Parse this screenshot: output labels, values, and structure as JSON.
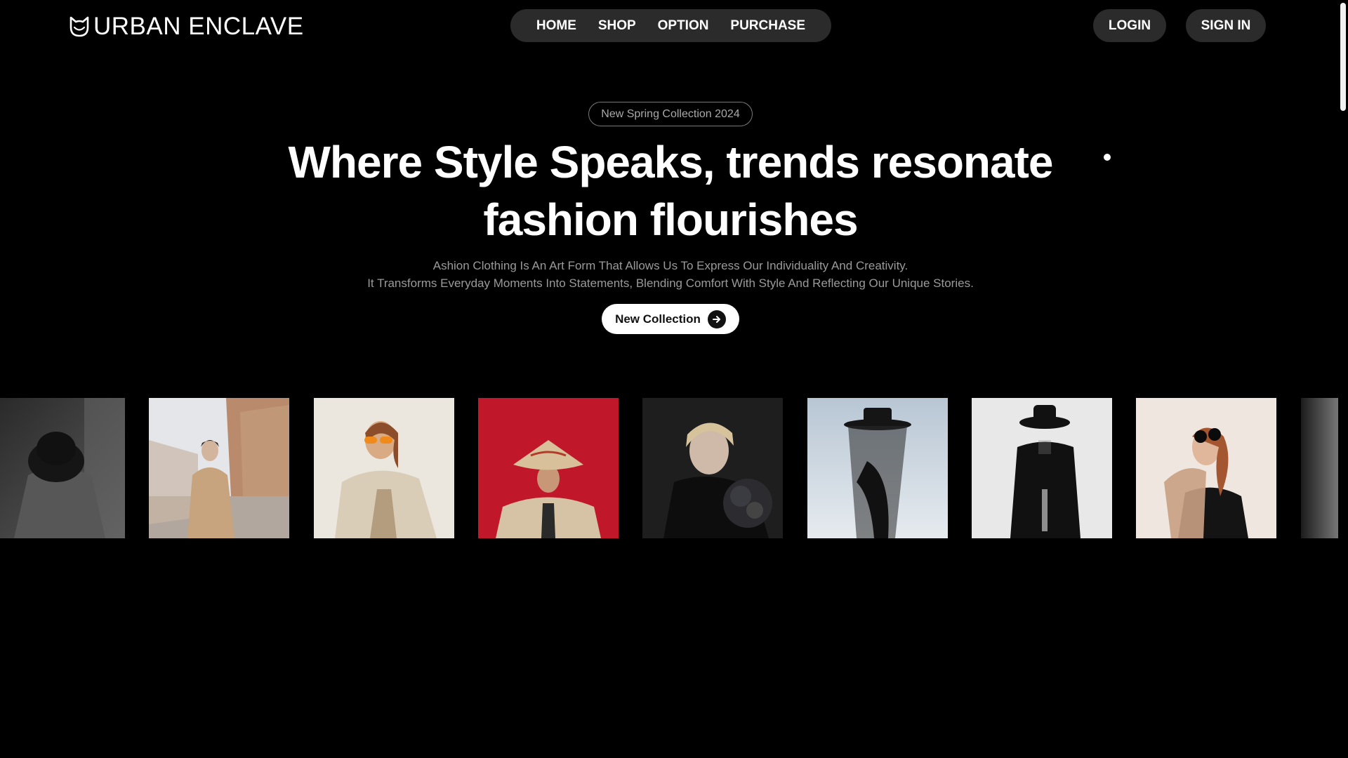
{
  "brand": {
    "name": "URBAN ENCLAVE",
    "logo_icon": "cat-head-icon"
  },
  "nav": {
    "items": [
      "HOME",
      "SHOP",
      "OPTION",
      "PURCHASE"
    ]
  },
  "auth": {
    "login": "LOGIN",
    "signin": "SIGN IN"
  },
  "hero": {
    "badge": "New Spring Collection 2024",
    "headline_line1": "Where Style Speaks, trends resonate",
    "headline_line2": "fashion flourishes",
    "description_line1": "Ashion Clothing Is An Art Form That Allows Us To Express Our Individuality And Creativity.",
    "description_line2": "It Transforms Everyday Moments Into Statements, Blending Comfort With Style And Reflecting Our Unique Stories.",
    "cta_label": "New Collection",
    "cta_icon": "arrow-right-icon"
  },
  "gallery": {
    "photos": [
      "man in black hat covering face",
      "woman in trench coat on city street",
      "woman with orange sunglasses and beige shirt",
      "woman in conical hat on red background",
      "blonde model in black with flower",
      "model in veiled hat on light blue background",
      "man in black hat and suit",
      "woman with sunglasses in black top",
      "dark model portrait"
    ]
  },
  "colors": {
    "background": "#000000",
    "pill": "#2b2b2b",
    "text": "#ffffff",
    "muted": "#9a9a9a",
    "red_backdrop": "#c0182a"
  }
}
